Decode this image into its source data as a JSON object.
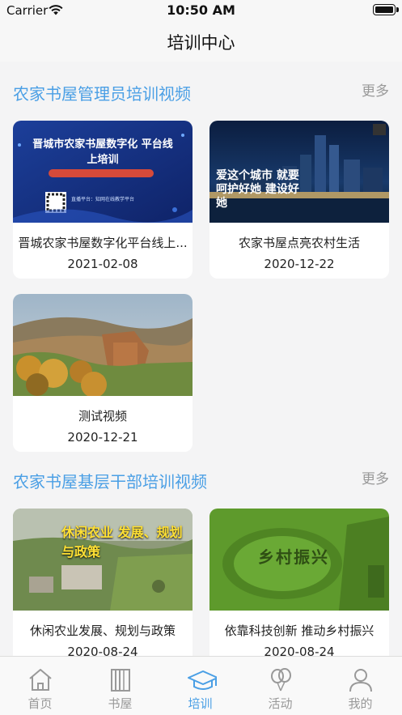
{
  "status_bar": {
    "carrier": "Carrier",
    "time": "10:50 AM"
  },
  "nav": {
    "title": "培训中心"
  },
  "sections": [
    {
      "title": "农家书屋管理员培训视频",
      "more": "更多",
      "videos": [
        {
          "title": "晋城农家书屋数字化平台线上...",
          "date": "2021-02-08",
          "thumb_text": "晋城市农家书屋数字化 平台线上培训",
          "thumb_sub": "直播平台：知网在线教学平台"
        },
        {
          "title": "农家书屋点亮农村生活",
          "date": "2020-12-22",
          "thumb_text": "爱这个城市 就要呵护好她 建设好她"
        },
        {
          "title": "测试视频",
          "date": "2020-12-21"
        }
      ]
    },
    {
      "title": "农家书屋基层干部培训视频",
      "more": "更多",
      "videos": [
        {
          "title": "休闲农业发展、规划与政策",
          "date": "2020-08-24",
          "thumb_text": "休闲农业 发展、规划与政策"
        },
        {
          "title": "依靠科技创新 推动乡村振兴",
          "date": "2020-08-24",
          "thumb_text": "乡村振兴"
        }
      ]
    }
  ],
  "tabs": [
    {
      "label": "首页",
      "icon": "home-icon"
    },
    {
      "label": "书屋",
      "icon": "bookshelf-icon"
    },
    {
      "label": "培训",
      "icon": "graduation-cap-icon",
      "active": true
    },
    {
      "label": "活动",
      "icon": "balloons-icon"
    },
    {
      "label": "我的",
      "icon": "person-icon"
    }
  ],
  "colors": {
    "accent": "#4a9fe5",
    "inactive": "#999999",
    "background": "#f4f4f5"
  }
}
